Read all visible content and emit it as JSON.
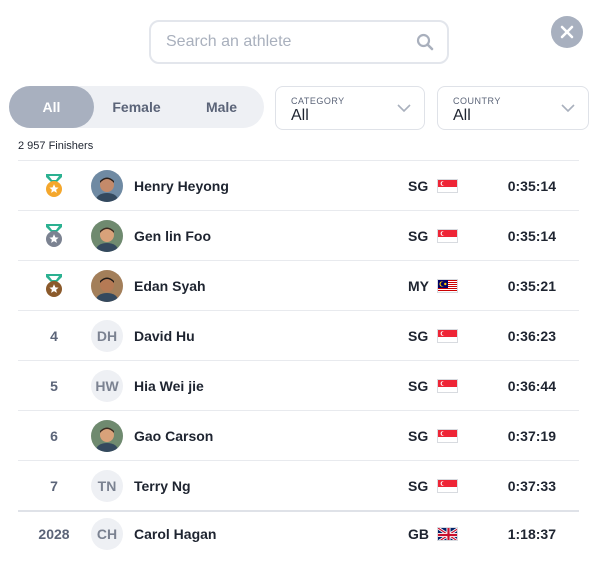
{
  "search": {
    "placeholder": "Search an athlete",
    "icon": "search-icon"
  },
  "close": {
    "icon": "close-icon"
  },
  "gender_filter": {
    "options": [
      {
        "label": "All",
        "active": true
      },
      {
        "label": "Female",
        "active": false
      },
      {
        "label": "Male",
        "active": false
      }
    ]
  },
  "category": {
    "label": "CATEGORY",
    "value": "All"
  },
  "country_filter": {
    "label": "COUNTRY",
    "value": "All"
  },
  "finishers_count": "2 957 Finishers",
  "colors": {
    "gold": "#f4a72c",
    "silver": "#7b8291",
    "bronze": "#8b5a2b",
    "ribbon": "#2bb191",
    "active_pill": "#a8b0bf"
  },
  "results": [
    {
      "rank": "1",
      "medal": "gold",
      "initials": "",
      "avatar": "photo",
      "name": "Henry Heyong",
      "country": "SG",
      "flag": "sg",
      "time": "0:35:14"
    },
    {
      "rank": "2",
      "medal": "silver",
      "initials": "",
      "avatar": "photo",
      "name": "Gen lin Foo",
      "country": "SG",
      "flag": "sg",
      "time": "0:35:14"
    },
    {
      "rank": "3",
      "medal": "bronze",
      "initials": "",
      "avatar": "photo",
      "name": "Edan Syah",
      "country": "MY",
      "flag": "my",
      "time": "0:35:21"
    },
    {
      "rank": "4",
      "medal": "",
      "initials": "DH",
      "avatar": "",
      "name": "David Hu",
      "country": "SG",
      "flag": "sg",
      "time": "0:36:23"
    },
    {
      "rank": "5",
      "medal": "",
      "initials": "HW",
      "avatar": "",
      "name": "Hia Wei jie",
      "country": "SG",
      "flag": "sg",
      "time": "0:36:44"
    },
    {
      "rank": "6",
      "medal": "",
      "initials": "",
      "avatar": "photo",
      "name": "Gao Carson",
      "country": "SG",
      "flag": "sg",
      "time": "0:37:19"
    },
    {
      "rank": "7",
      "medal": "",
      "initials": "TN",
      "avatar": "",
      "name": "Terry Ng",
      "country": "SG",
      "flag": "sg",
      "time": "0:37:33"
    },
    {
      "rank": "2028",
      "medal": "",
      "initials": "CH",
      "avatar": "",
      "name": "Carol Hagan",
      "country": "GB",
      "flag": "gb",
      "time": "1:18:37"
    }
  ]
}
